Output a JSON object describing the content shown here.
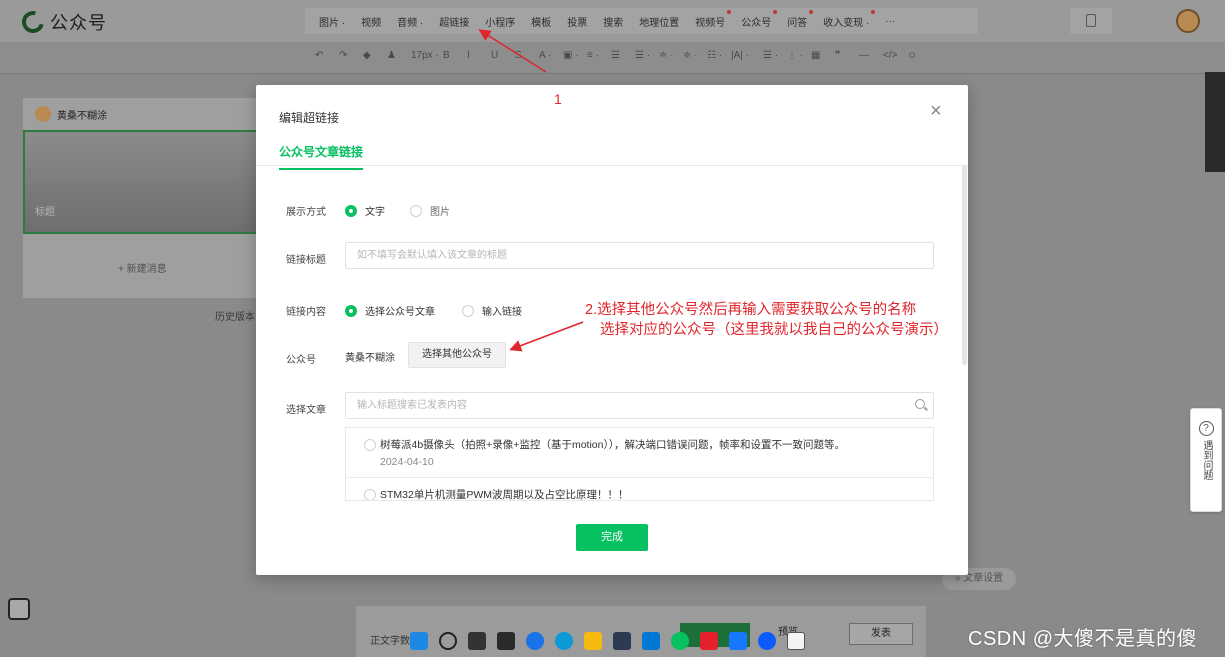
{
  "app": {
    "name": "公众号"
  },
  "menu": [
    {
      "label": "图片",
      "caret": true,
      "dot": false
    },
    {
      "label": "视频",
      "caret": false,
      "dot": false
    },
    {
      "label": "音频",
      "caret": true,
      "dot": false
    },
    {
      "label": "超链接",
      "caret": false,
      "dot": false
    },
    {
      "label": "小程序",
      "caret": false,
      "dot": false
    },
    {
      "label": "模板",
      "caret": false,
      "dot": false
    },
    {
      "label": "投票",
      "caret": false,
      "dot": false
    },
    {
      "label": "搜索",
      "caret": false,
      "dot": false
    },
    {
      "label": "地理位置",
      "caret": false,
      "dot": false
    },
    {
      "label": "视频号",
      "caret": false,
      "dot": true
    },
    {
      "label": "公众号",
      "caret": false,
      "dot": true
    },
    {
      "label": "问答",
      "caret": false,
      "dot": true
    },
    {
      "label": "收入变现",
      "caret": true,
      "dot": true
    },
    {
      "label": "···",
      "caret": false,
      "dot": false
    }
  ],
  "toolbar": {
    "font_size": "17px",
    "items": [
      "↶",
      "↷",
      "◆",
      "♟",
      "17px ·",
      "B",
      "I",
      "U",
      "S",
      "A ·",
      "▣ ·",
      "≡ ·",
      "☰",
      "☰ ·",
      "≐ ·",
      "≑ ·",
      "☷ ·",
      "|A| ·",
      "☰ ·",
      "⋮ ·",
      "▦",
      "❞",
      "—",
      "</>",
      "☺"
    ]
  },
  "left_panel": {
    "account": "黄桑不糊涂",
    "cover_label": "标题",
    "new_message": "+ 新建消息",
    "history": "历史版本"
  },
  "modal": {
    "title": "编辑超链接",
    "close": "×",
    "tab": "公众号文章链接",
    "display_mode": {
      "label": "展示方式",
      "options": [
        {
          "label": "文字",
          "selected": true
        },
        {
          "label": "图片",
          "selected": false
        }
      ]
    },
    "link_title": {
      "label": "链接标题",
      "placeholder": "如不填写会默认填入该文章的标题"
    },
    "link_content": {
      "label": "链接内容",
      "options": [
        {
          "label": "选择公众号文章",
          "selected": true
        },
        {
          "label": "输入链接",
          "selected": false
        }
      ]
    },
    "account": {
      "label": "公众号",
      "name": "黄桑不糊涂",
      "select_other": "选择其他公众号"
    },
    "article_search": {
      "label": "选择文章",
      "placeholder": "输入标题搜索已发表内容"
    },
    "articles": [
      {
        "title": "树莓派4b摄像头（拍照+录像+监控（基于motion）），解决端口错误问题，帧率和设置不一致问题等。",
        "date": "2024-04-10"
      },
      {
        "title": "STM32单片机测量PWM波周期以及占空比原理！！！",
        "date": ""
      }
    ],
    "done": "完成"
  },
  "annotations": {
    "step1": "1",
    "step2_line1": "2.选择其他公众号然后再输入需要获取公众号的名称",
    "step2_line2": "选择对应的公众号（这里我就以我自己的公众号演示）"
  },
  "bottom": {
    "word_count": "正文字数",
    "preview": "预览",
    "publish": "发表",
    "article_settings": "文章设置"
  },
  "help": {
    "icon": "?",
    "text": "遇到问题"
  },
  "watermark": "CSDN @大傻不是真的傻",
  "colors": {
    "accent": "#07c160",
    "annotation": "#e0252b"
  }
}
